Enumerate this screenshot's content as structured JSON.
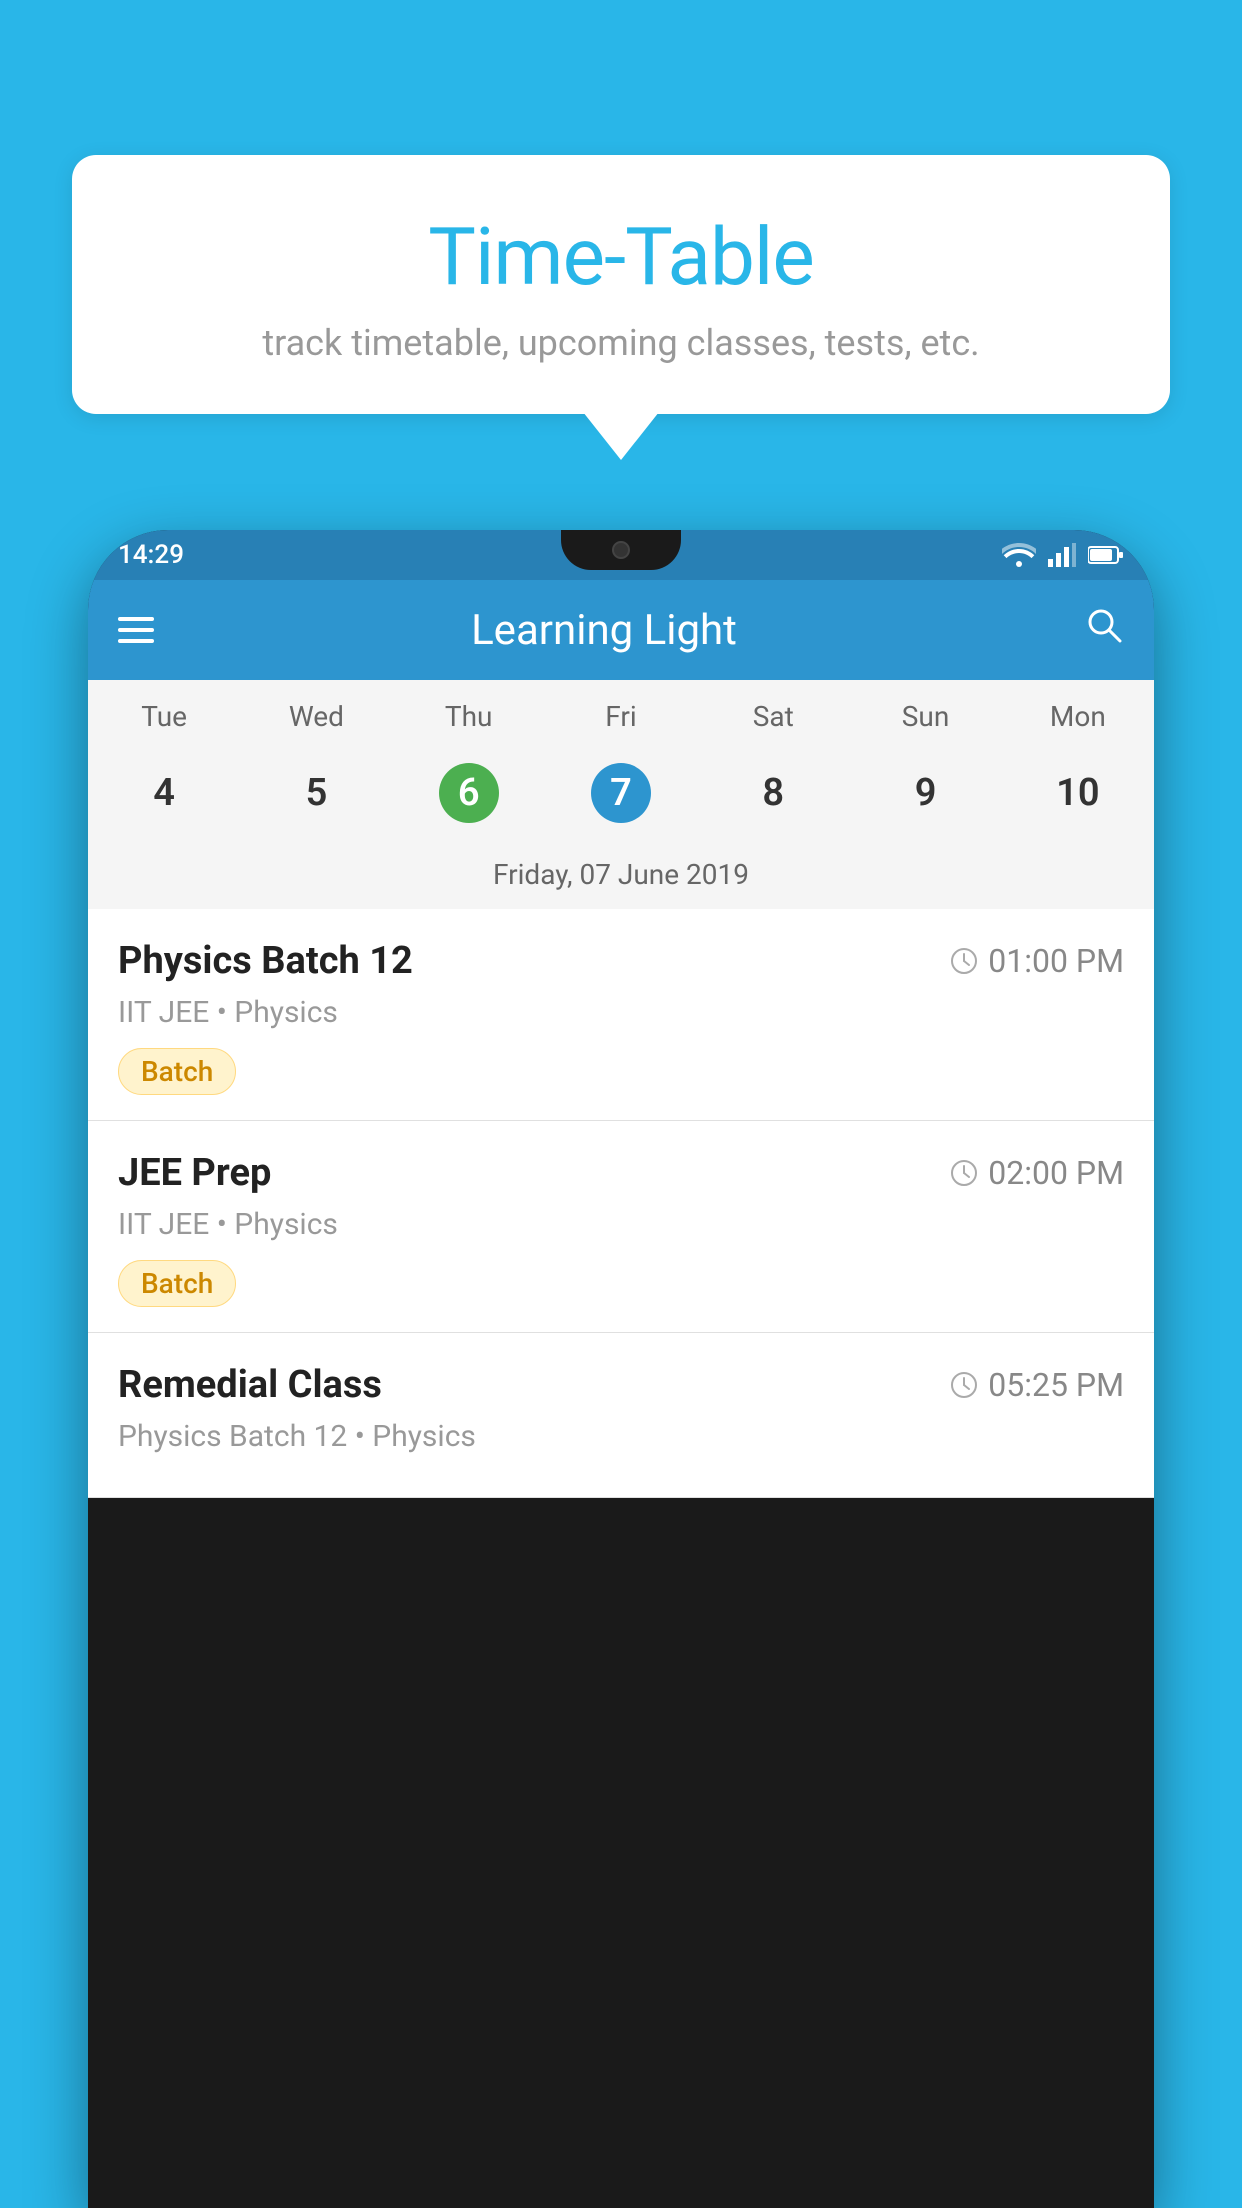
{
  "background_color": "#29B6E8",
  "bubble": {
    "title": "Time-Table",
    "subtitle": "track timetable, upcoming classes, tests, etc."
  },
  "app": {
    "name": "Learning Light",
    "time": "14:29"
  },
  "calendar": {
    "days": [
      "Tue",
      "Wed",
      "Thu",
      "Fri",
      "Sat",
      "Sun",
      "Mon"
    ],
    "dates": [
      "4",
      "5",
      "6",
      "7",
      "8",
      "9",
      "10"
    ],
    "today_index": 2,
    "selected_index": 3,
    "selected_label": "Friday, 07 June 2019"
  },
  "classes": [
    {
      "name": "Physics Batch 12",
      "time": "01:00 PM",
      "meta": "IIT JEE • Physics",
      "badge": "Batch"
    },
    {
      "name": "JEE Prep",
      "time": "02:00 PM",
      "meta": "IIT JEE • Physics",
      "badge": "Batch"
    },
    {
      "name": "Remedial Class",
      "time": "05:25 PM",
      "meta": "Physics Batch 12 • Physics",
      "badge": null
    }
  ],
  "labels": {
    "hamburger_label": "Menu",
    "search_label": "Search",
    "batch_badge": "Batch"
  }
}
